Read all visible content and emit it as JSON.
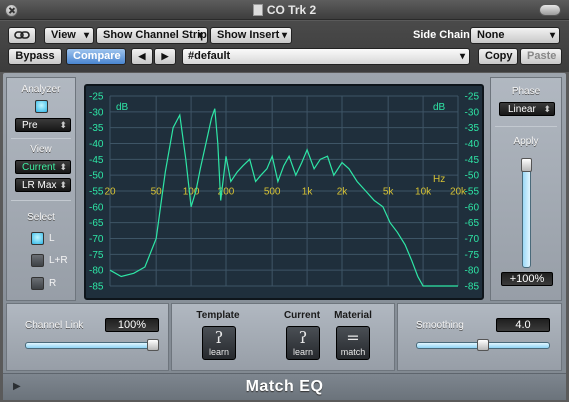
{
  "window": {
    "title": "CO Trk 2"
  },
  "toolbar": {
    "link_icon": "chain-link-icon",
    "view_label": "View",
    "show_channel_strip_label": "Show Channel Strip",
    "show_insert_label": "Show Insert",
    "side_chain_label": "Side Chain:",
    "side_chain_value": "None",
    "bypass_label": "Bypass",
    "compare_label": "Compare",
    "prev_label": "◀",
    "next_label": "▶",
    "preset_value": "#default",
    "copy_label": "Copy",
    "paste_label": "Paste"
  },
  "analyzer": {
    "title": "Analyzer",
    "mode_value": "Pre",
    "view_title": "View",
    "view_value": "Current",
    "scale_value": "LR Max",
    "select_title": "Select",
    "options": [
      {
        "label": "L",
        "selected": true
      },
      {
        "label": "L+R",
        "selected": false
      },
      {
        "label": "R",
        "selected": false
      }
    ]
  },
  "display": {
    "db_unit": "dB",
    "hz_unit": "Hz",
    "db_ticks": [
      "-25",
      "-30",
      "-35",
      "-40",
      "-45",
      "-50",
      "-55",
      "-60",
      "-65",
      "-70",
      "-75",
      "-80",
      "-85"
    ],
    "freq_ticks": [
      "20",
      "50",
      "100",
      "200",
      "500",
      "1k",
      "2k",
      "5k",
      "10k",
      "20k"
    ],
    "grid_color": "#3e5566",
    "curve_color": "#2ee6a6",
    "tick_color": "#2ee6a6",
    "freq_color": "#d6c234"
  },
  "chart_data": {
    "type": "line",
    "xlabel": "Hz",
    "ylabel": "dB",
    "x_scale": "log",
    "xlim": [
      20,
      20000
    ],
    "ylim": [
      -85,
      -25
    ],
    "series": [
      {
        "x": [
          20,
          25,
          32,
          40,
          50,
          60,
          70,
          80,
          90,
          100,
          110,
          120,
          140,
          150,
          160,
          170,
          180,
          200,
          220,
          250,
          280,
          320,
          360,
          400,
          450,
          500,
          560,
          630,
          700,
          800,
          900,
          1000,
          1150,
          1300,
          1500,
          1700,
          2000,
          2300,
          2700,
          3200,
          3800,
          4500,
          5200,
          6000,
          7000,
          8000,
          9000,
          10000,
          20000
        ],
        "y": [
          -80,
          -82,
          -81,
          -79,
          -70,
          -49,
          -35,
          -31,
          -45,
          -60,
          -55,
          -48,
          -37,
          -32,
          -29,
          -40,
          -58,
          -44,
          -52,
          -49,
          -47,
          -45,
          -52,
          -50,
          -48,
          -44,
          -52,
          -47,
          -44,
          -50,
          -46,
          -42,
          -48,
          -45,
          -44,
          -50,
          -46,
          -48,
          -52,
          -55,
          -58,
          -60,
          -65,
          -68,
          -72,
          -77,
          -82,
          -85,
          -85
        ]
      }
    ]
  },
  "phase": {
    "title": "Phase",
    "value": "Linear"
  },
  "apply": {
    "title": "Apply",
    "value": "+100%",
    "level": 1.0
  },
  "channel_link": {
    "title": "Channel Link",
    "value": "100%",
    "level": 1.0
  },
  "template": {
    "title": "Template",
    "button_caption": "learn"
  },
  "current": {
    "title": "Current",
    "button_caption": "learn"
  },
  "material": {
    "title": "Material",
    "button_caption": "match"
  },
  "smoothing": {
    "title": "Smoothing",
    "value": "4.0",
    "level": 0.5
  },
  "footer": {
    "plugin_name": "Match EQ",
    "disclosure_icon": "disclosure-triangle-icon"
  }
}
